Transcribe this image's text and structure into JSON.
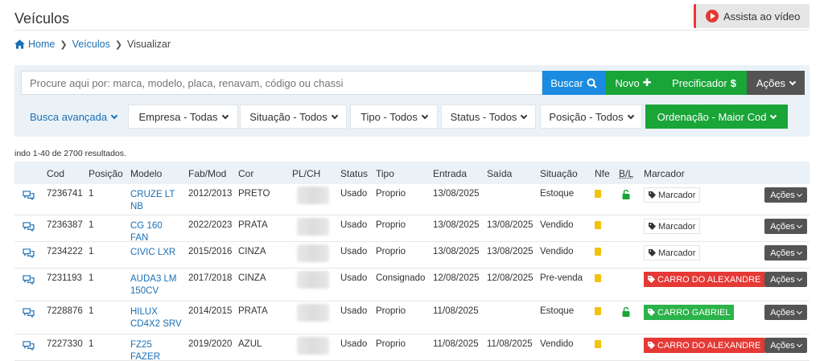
{
  "page": {
    "title": "Veículos",
    "watch_video": "Assista ao vídeo"
  },
  "breadcrumb": [
    "Home",
    "Veículos",
    "Visualizar"
  ],
  "search": {
    "placeholder": "Procure aqui por: marca, modelo, placa, renavam, código ou chassi",
    "buscar": "Buscar",
    "novo": "Novo",
    "precificador": "Precificador",
    "acoes": "Ações"
  },
  "filters": {
    "advanced": "Busca avançada",
    "empresa": "Empresa - Todas",
    "situacao": "Situação - Todos",
    "tipo": "Tipo - Todos",
    "status": "Status - Todos",
    "posicao": "Posição - Todos",
    "ordenacao": "Ordenação - Maior Cod"
  },
  "results_text": "indo 1-40 de 2700 resultados.",
  "table": {
    "headers": {
      "cod": "Cod",
      "posicao": "Posição",
      "modelo": "Modelo",
      "fabmod": "Fab/Mod",
      "cor": "Cor",
      "plch": "PL/CH",
      "status": "Status",
      "tipo": "Tipo",
      "entrada": "Entrada",
      "saida": "Saída",
      "situacao": "Situação",
      "nfe": "Nfe",
      "bl": "B/L",
      "marcador": "Marcador"
    },
    "row_action": "Ações",
    "rows": [
      {
        "cod": "7236741",
        "posicao": "1",
        "modelo": "CRUZE LT NB",
        "fabmod": "2012/2013",
        "cor": "PRETO",
        "status": "Usado",
        "tipo": "Proprio",
        "entrada": "13/08/2025",
        "saida": "",
        "situacao": "Estoque",
        "lock": true,
        "marker": "Marcador",
        "marker_style": "plain"
      },
      {
        "cod": "7236387",
        "posicao": "1",
        "modelo": "CG 160 FAN",
        "fabmod": "2022/2023",
        "cor": "PRATA",
        "status": "Usado",
        "tipo": "Proprio",
        "entrada": "13/08/2025",
        "saida": "13/08/2025",
        "situacao": "Vendido",
        "lock": false,
        "marker": "Marcador",
        "marker_style": "plain"
      },
      {
        "cod": "7234222",
        "posicao": "1",
        "modelo": "CIVIC LXR",
        "fabmod": "2015/2016",
        "cor": "CINZA",
        "status": "Usado",
        "tipo": "Proprio",
        "entrada": "13/08/2025",
        "saida": "13/08/2025",
        "situacao": "Vendido",
        "lock": false,
        "marker": "Marcador",
        "marker_style": "plain"
      },
      {
        "cod": "7231193",
        "posicao": "1",
        "modelo": "AUDA3 LM 150CV",
        "fabmod": "2017/2018",
        "cor": "CINZA",
        "status": "Usado",
        "tipo": "Consignado",
        "entrada": "12/08/2025",
        "saida": "12/08/2025",
        "situacao": "Pre-venda",
        "lock": false,
        "marker": "CARRO DO ALEXANDRE",
        "marker_style": "red"
      },
      {
        "cod": "7228876",
        "posicao": "1",
        "modelo": "HILUX CD4X2 SRV",
        "fabmod": "2014/2015",
        "cor": "PRATA",
        "status": "Usado",
        "tipo": "Proprio",
        "entrada": "11/08/2025",
        "saida": "",
        "situacao": "Estoque",
        "lock": true,
        "marker": "CARRO GABRIEL",
        "marker_style": "green"
      },
      {
        "cod": "7227330",
        "posicao": "1",
        "modelo": "FZ25 FAZER",
        "fabmod": "2019/2020",
        "cor": "AZUL",
        "status": "Usado",
        "tipo": "Proprio",
        "entrada": "11/08/2025",
        "saida": "11/08/2025",
        "situacao": "Vendido",
        "lock": false,
        "marker": "CARRO DO ALEXANDRE",
        "marker_style": "red"
      }
    ]
  },
  "icons": {
    "home": "home-icon",
    "search": "search-icon",
    "plus": "plus-icon",
    "dollar": "dollar-icon",
    "chat": "chat-icon",
    "nfe": "document-icon",
    "lock": "unlock-icon",
    "tag": "tag-icon",
    "video": "play-icon"
  },
  "colors": {
    "primary": "#1a8be0",
    "success": "#19a538",
    "dark": "#545454",
    "danger": "#e53935",
    "panel": "#eaf2f8",
    "link": "#1a6fb5",
    "nfe": "#f2c20c"
  }
}
